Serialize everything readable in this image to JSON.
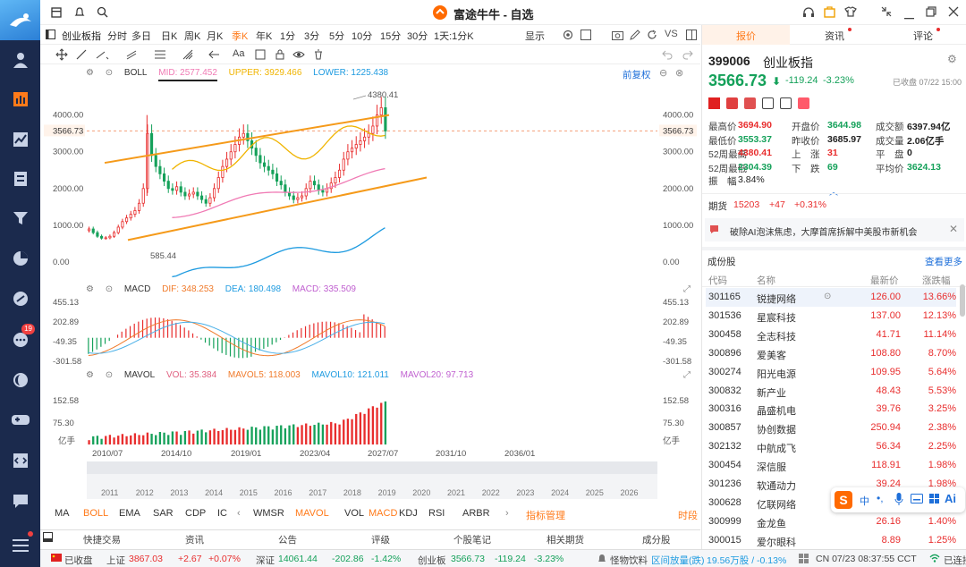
{
  "app": {
    "title": "富途牛牛 - 自选",
    "sidebar_badge": "19"
  },
  "toolbar": {
    "name_tab": "创业板指",
    "periods": [
      "分时",
      "多日",
      "日K",
      "周K",
      "月K",
      "季K",
      "年K",
      "1分",
      "3分",
      "5分",
      "10分",
      "15分",
      "30分",
      "1天:1分K"
    ],
    "active_period": "季K",
    "display": "显示",
    "vs": "VS"
  },
  "boll": {
    "label": "BOLL",
    "mid": "MID: 2577.452",
    "upper": "UPPER: 3929.466",
    "lower": "LOWER: 1225.438",
    "prefix": "前复权",
    "high_label": "4380.41",
    "low_label": "585.44",
    "cur_price": "3566.73",
    "yticks": [
      "4000.00",
      "3000.00",
      "2000.00",
      "1000.00",
      "0.00"
    ]
  },
  "macd": {
    "label": "MACD",
    "dif": "DIF: 348.253",
    "dea": "DEA: 180.498",
    "macd": "MACD: 335.509",
    "yticks": [
      "455.13",
      "202.89",
      "-49.35",
      "-301.58"
    ]
  },
  "mavol": {
    "label": "MAVOL",
    "vol": "VOL: 35.384",
    "ma5": "MAVOL5: 118.003",
    "ma10": "MAVOL10: 121.011",
    "ma20": "MAVOL20: 97.713",
    "yticks": [
      "152.58",
      "75.30",
      "亿手"
    ]
  },
  "xaxis": [
    "2010/07",
    "2014/10",
    "2019/01",
    "2023/04",
    "2027/07",
    "2031/10",
    "2036/01"
  ],
  "timeline": [
    "2011",
    "2012",
    "2013",
    "2014",
    "2015",
    "2016",
    "2017",
    "2018",
    "2019",
    "2020",
    "2021",
    "2022",
    "2023",
    "2024",
    "2025",
    "2026"
  ],
  "indicators": [
    "MA",
    "BOLL",
    "EMA",
    "SAR",
    "CDP",
    "IC",
    "WMSR",
    "MAVOL",
    "VOL",
    "MACD",
    "KDJ",
    "RSI",
    "ARBR",
    "指标管理",
    "时段"
  ],
  "bottom_tabs": [
    "快捷交易",
    "资讯",
    "公告",
    "评级",
    "个股笔记",
    "相关期货",
    "成分股"
  ],
  "status": {
    "closed": "已收盘",
    "sh_name": "上证",
    "sh_val": "3867.03",
    "sh_chg": "+2.67",
    "sh_pct": "+0.07%",
    "sz_name": "深证",
    "sz_val": "14061.44",
    "sz_chg": "-202.86",
    "sz_pct": "-1.42%",
    "cy_name": "创业板",
    "cy_val": "3566.73",
    "cy_chg": "-119.24",
    "cy_pct": "-3.23%",
    "news": "怪物饮料",
    "vol_text": "区间放量(跌)",
    "vol_val": "19.56万股 / -0.13%",
    "time": "CN 07/23 08:37:55 CCT",
    "conn": "已连接"
  },
  "right": {
    "tabs": [
      "报价",
      "资讯",
      "评论"
    ],
    "code": "399006",
    "name": "创业板指",
    "price": "3566.73",
    "chg": "-119.24",
    "pct": "-3.23%",
    "close_time": "已收盘 07/22 15:00",
    "stats": [
      [
        "最高价",
        "3694.90",
        "开盘价",
        "3644.98",
        "成交额",
        "6397.94亿"
      ],
      [
        "最低价",
        "3553.37",
        "昨收价",
        "3685.97",
        "成交量",
        "2.06亿手"
      ],
      [
        "52周最高",
        "4380.41",
        "上　涨",
        "31",
        "平　盘",
        "0"
      ],
      [
        "52周最低",
        "2304.39",
        "下　跌",
        "69",
        "平均价",
        "3624.13"
      ]
    ],
    "amp_label": "振　幅",
    "amp_val": "3.84%",
    "futures_label": "期货",
    "futures_val": "15203",
    "futures_chg": "+47",
    "futures_pct": "+0.31%",
    "news": "破除AI泡沫焦虑，大摩首席拆解中美股市新机会",
    "components_title": "成份股",
    "more": "查看更多",
    "headers": [
      "代码",
      "名称",
      "最新价",
      "涨跌幅"
    ],
    "rows": [
      [
        "301165",
        "锐捷网络",
        "126.00",
        "13.66%"
      ],
      [
        "301536",
        "星宸科技",
        "137.00",
        "12.13%"
      ],
      [
        "300458",
        "全志科技",
        "41.71",
        "11.14%"
      ],
      [
        "300896",
        "爱美客",
        "108.80",
        "8.70%"
      ],
      [
        "300274",
        "阳光电源",
        "109.95",
        "5.64%"
      ],
      [
        "300832",
        "新产业",
        "48.43",
        "5.53%"
      ],
      [
        "300316",
        "晶盛机电",
        "39.76",
        "3.25%"
      ],
      [
        "300857",
        "协创数据",
        "250.94",
        "2.38%"
      ],
      [
        "302132",
        "中航成飞",
        "56.34",
        "2.25%"
      ],
      [
        "300454",
        "深信服",
        "118.91",
        "1.98%"
      ],
      [
        "301236",
        "软通动力",
        "39.24",
        "1.98%"
      ],
      [
        "300628",
        "亿联网络",
        "",
        "1.95%"
      ],
      [
        "300999",
        "金龙鱼",
        "26.16",
        "1.40%"
      ],
      [
        "300015",
        "爱尔眼科",
        "8.89",
        "1.25%"
      ]
    ]
  },
  "colors": {
    "up": "#e82d2d",
    "down": "#15a15a",
    "accent": "#ff7a1a",
    "boll_upper": "#f0b400",
    "boll_mid": "#f07ab4",
    "boll_lower": "#1e9be0",
    "channel": "#f59a1a"
  }
}
